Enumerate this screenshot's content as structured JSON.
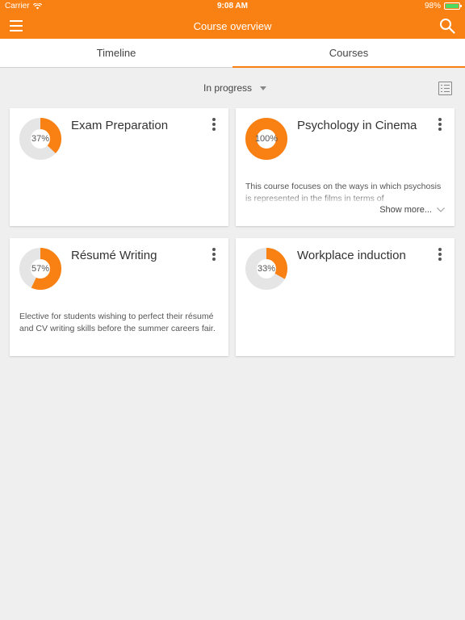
{
  "status_bar": {
    "carrier": "Carrier",
    "time": "9:08 AM",
    "battery": "98%"
  },
  "header": {
    "title": "Course overview"
  },
  "tabs": [
    {
      "label": "Timeline",
      "active": false
    },
    {
      "label": "Courses",
      "active": true
    }
  ],
  "filter": {
    "selected": "In progress"
  },
  "colors": {
    "accent": "#f98012",
    "track": "#e5e5e5",
    "battery": "#4cd964"
  },
  "courses": [
    {
      "title": "Exam Preparation",
      "progress_label": "37%",
      "progress": 37,
      "description": ""
    },
    {
      "title": "Psychology in Cinema",
      "progress_label": "100%",
      "progress": 100,
      "description": "This course focuses on the ways in which psychosis is represented in the films in terms of",
      "show_more": "Show more..."
    },
    {
      "title": "Résumé Writing",
      "progress_label": "57%",
      "progress": 57,
      "description": "Elective for students wishing to perfect their résumé and CV writing skills before the summer careers fair."
    },
    {
      "title": "Workplace induction",
      "progress_label": "33%",
      "progress": 33,
      "description": ""
    }
  ]
}
